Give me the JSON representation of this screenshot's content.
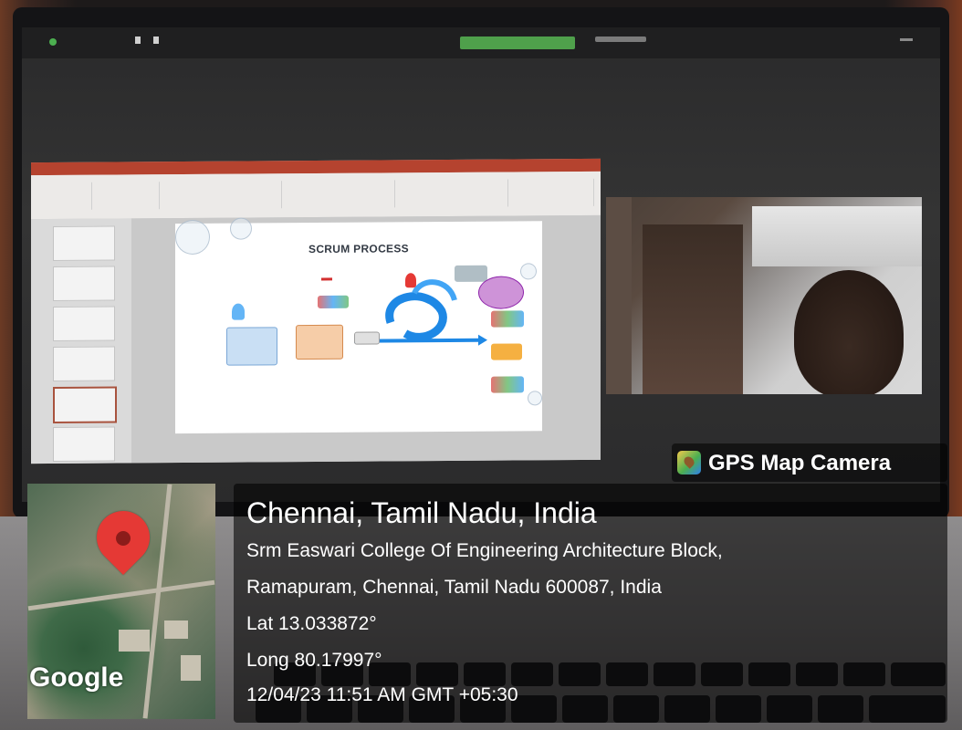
{
  "gps_overlay": {
    "brand": "GPS Map Camera",
    "city": "Chennai, Tamil Nadu, India",
    "address_line1": "Srm Easwari College Of Engineering Architecture Block,",
    "address_line2": "Ramapuram, Chennai, Tamil Nadu 600087, India",
    "latitude": "Lat 13.033872°",
    "longitude": "Long 80.17997°",
    "datetime": "12/04/23 11:51 AM GMT +05:30"
  },
  "map": {
    "watermark": "Google",
    "pin_icon": "location-pin-icon",
    "pin_color": "#e53935"
  },
  "shared_screen": {
    "slide_title": "SCRUM PROCESS"
  },
  "colors": {
    "ppt_titlebar": "#b5432f",
    "zoom_tag": "#4fa04b",
    "slide_arrow": "#1e88e5"
  }
}
